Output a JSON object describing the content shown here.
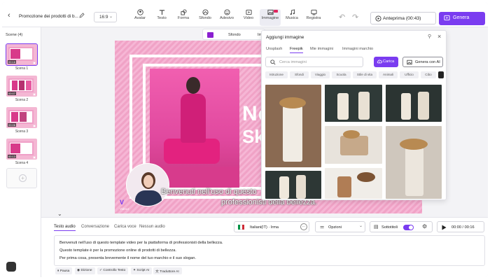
{
  "topbar": {
    "back_icon": "chevron-left-icon",
    "project_title": "Promozione dei prodotti di b...",
    "aspect_ratio": "16:9",
    "tools": [
      {
        "label": "Avatar",
        "icon": "avatar-icon"
      },
      {
        "label": "Testo",
        "icon": "text-icon"
      },
      {
        "label": "Forma",
        "icon": "shape-icon"
      },
      {
        "label": "Sfondo",
        "icon": "background-icon"
      },
      {
        "label": "Adesivo",
        "icon": "sticker-icon"
      },
      {
        "label": "Video",
        "icon": "video-icon"
      },
      {
        "label": "Immagine",
        "icon": "image-icon",
        "active": true
      },
      {
        "label": "Musica",
        "icon": "music-icon"
      },
      {
        "label": "Registra",
        "icon": "record-icon"
      }
    ],
    "preview_label": "Anteprima (00:43)",
    "generate_label": "Genera"
  },
  "scenes": {
    "title": "Scene (4)",
    "items": [
      {
        "label": "Scena 1",
        "duration": "00:16"
      },
      {
        "label": "Scena 2",
        "duration": "00:07"
      },
      {
        "label": "Scena 3",
        "duration": "00:06"
      },
      {
        "label": "Scena 4",
        "duration": "00:13"
      }
    ],
    "add_icon": "plus-icon"
  },
  "context_toolbar": {
    "background_label": "Sfondo",
    "image_label": "Im"
  },
  "canvas": {
    "headline_line1": "No",
    "headline_line2": "Sk",
    "subtitle_line1": "Benvenuti nell'uso di questo",
    "subtitle_line2": "professionisti della bellezza.",
    "avatar_name": "Vidnoz"
  },
  "image_panel": {
    "title": "Aggiungi immagine",
    "tabs": [
      "Unsplash",
      "Freepik",
      "Mie immagini",
      "Immagini marchio"
    ],
    "active_tab": "Freepik",
    "search_placeholder": "Cerca immagini",
    "upload_label": "Carica",
    "generate_ai_label": "Genera con AI",
    "chips": [
      "Istruzione",
      "Sfondi",
      "Viaggio",
      "Scuola",
      "Stile di vita",
      "Animali",
      "Ufficio",
      "Cibo"
    ]
  },
  "bottom": {
    "tabs": [
      "Testo audio",
      "Conversazione",
      "Carica voce",
      "Nessun audio"
    ],
    "active_tab": "Testo audio",
    "voice_flag_colors": [
      "#009246",
      "#ffffff",
      "#ce2b37"
    ],
    "voice_label": "Italiani(IT) · Irma",
    "options_label": "Opzioni",
    "subtitles_label": "Sottotitoli",
    "subtitles_on": true,
    "time_label": "00:00 / 00:16",
    "script_lines": [
      "Benvenuti nell'uso di questo template video per la piattaforma di professionisti della bellezza.",
      "Questo template è per la promozione online di prodotti di bellezza.",
      "Per prima cosa, presenta brevemente il nome del tuo marchio e il suo slogan."
    ],
    "actions": [
      {
        "label": "Pausa",
        "icon": "pause-icon"
      },
      {
        "label": "Dizione",
        "icon": "dictation-icon"
      },
      {
        "label": "Controllo Testo",
        "icon": "check-text-icon"
      },
      {
        "label": "Script AI",
        "icon": "script-ai-icon"
      },
      {
        "label": "Traduttore AI",
        "icon": "translate-icon"
      }
    ]
  },
  "colors": {
    "accent": "#7a3cf0",
    "canvas_pink": "#f3a9cc"
  }
}
